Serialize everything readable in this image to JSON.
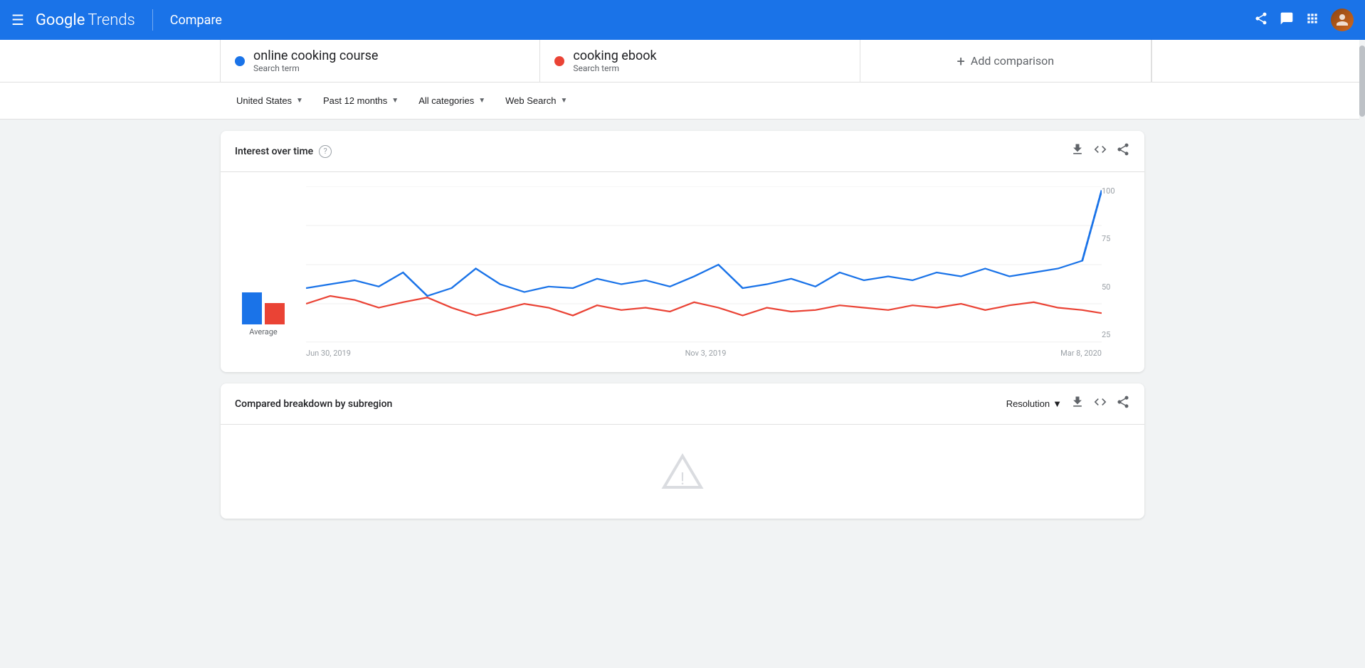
{
  "header": {
    "menu_label": "☰",
    "logo_google": "Google",
    "logo_trends": "Trends",
    "compare": "Compare",
    "share_icon": "share",
    "feedback_icon": "feedback",
    "apps_icon": "apps"
  },
  "search_terms": [
    {
      "id": "term1",
      "name": "online cooking course",
      "type": "Search term",
      "dot_color": "blue"
    },
    {
      "id": "term2",
      "name": "cooking ebook",
      "type": "Search term",
      "dot_color": "red"
    }
  ],
  "add_comparison": "+ Add comparison",
  "filters": {
    "location": "United States",
    "time": "Past 12 months",
    "category": "All categories",
    "type": "Web Search"
  },
  "interest_over_time": {
    "title": "Interest over time",
    "y_labels": [
      "100",
      "75",
      "50",
      "25"
    ],
    "x_labels": [
      "Jun 30, 2019",
      "Nov 3, 2019",
      "Mar 8, 2020"
    ],
    "avg_label": "Average"
  },
  "subregion": {
    "title": "Compared breakdown by subregion",
    "resolution": "Resolution"
  }
}
